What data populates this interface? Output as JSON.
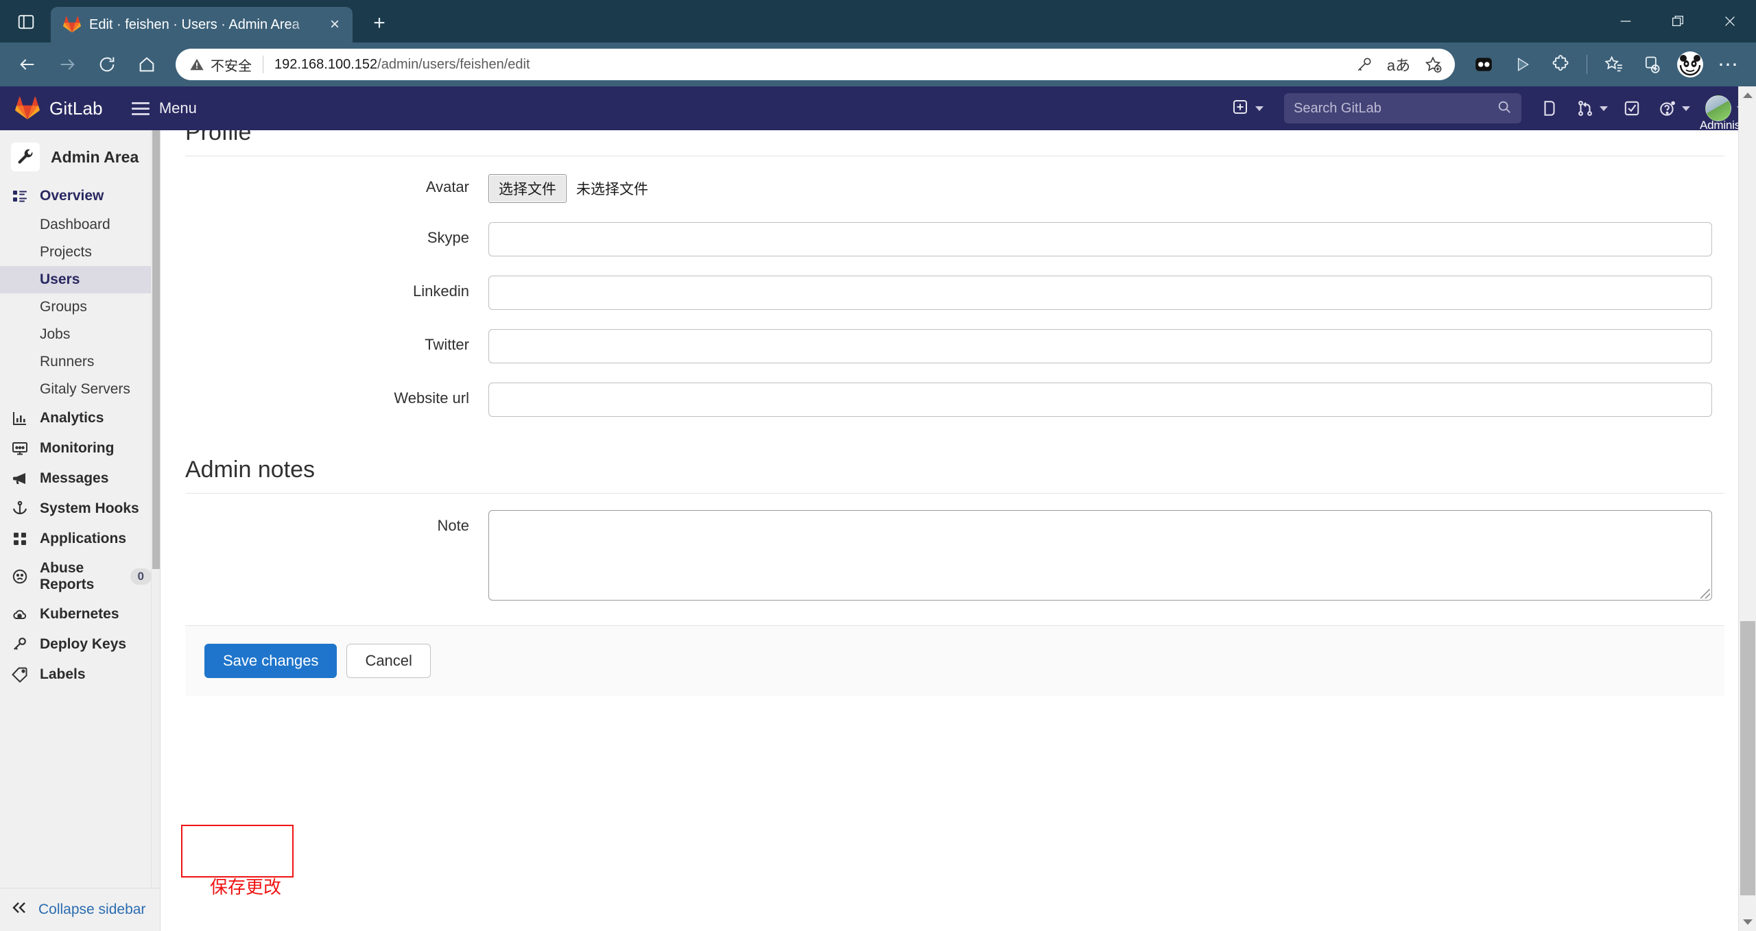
{
  "browser": {
    "tab": {
      "title": "Edit · feishen · Users · Admin Area",
      "favicon_name": "gitlab-favicon",
      "close_label": "×"
    },
    "newtab_label": "+",
    "omnibox": {
      "security_label": "不安全",
      "url_host": "192.168.100.152",
      "url_path": "/admin/users/feishen/edit",
      "icons": [
        "key-icon",
        "translate-icon",
        "add-favorite-icon"
      ]
    },
    "nav_icons": [
      "back-icon",
      "forward-icon",
      "reload-icon",
      "home-icon"
    ],
    "toolbar_icons": [
      "split-screen-icon",
      "play-icon",
      "extensions-icon",
      "favorites-icon",
      "collections-icon",
      "profile-avatar-icon",
      "settings-more-icon"
    ],
    "window_controls": [
      "minimize-icon",
      "restore-icon",
      "close-icon"
    ]
  },
  "gitlab_nav": {
    "brand": "GitLab",
    "menu_label": "Menu",
    "search_placeholder": "Search GitLab",
    "plus_icon": "plus-square-icon",
    "right_icons": [
      "issues-icon",
      "merge-requests-icon",
      "todos-icon",
      "help-icon"
    ],
    "user_name": "Administrator",
    "bg_color": "#292961"
  },
  "sidebar": {
    "header": "Admin Area",
    "header_icon": "wrench-icon",
    "collapse_label": "Collapse sidebar",
    "collapse_icon": "double-chevron-left-icon",
    "items": [
      {
        "label": "Overview",
        "icon": "overview-list-icon",
        "type": "section",
        "active": true
      },
      {
        "label": "Dashboard",
        "type": "sub"
      },
      {
        "label": "Projects",
        "type": "sub"
      },
      {
        "label": "Users",
        "type": "sub",
        "active": true
      },
      {
        "label": "Groups",
        "type": "sub"
      },
      {
        "label": "Jobs",
        "type": "sub"
      },
      {
        "label": "Runners",
        "type": "sub"
      },
      {
        "label": "Gitaly Servers",
        "type": "sub"
      },
      {
        "label": "Analytics",
        "icon": "chart-bar-icon",
        "type": "section"
      },
      {
        "label": "Monitoring",
        "icon": "monitor-icon",
        "type": "section"
      },
      {
        "label": "Messages",
        "icon": "megaphone-icon",
        "type": "section"
      },
      {
        "label": "System Hooks",
        "icon": "anchor-icon",
        "type": "section"
      },
      {
        "label": "Applications",
        "icon": "grid-apps-icon",
        "type": "section"
      },
      {
        "label": "Abuse Reports",
        "icon": "sad-face-icon",
        "type": "section",
        "badge": "0"
      },
      {
        "label": "Kubernetes",
        "icon": "cloud-gear-icon",
        "type": "section"
      },
      {
        "label": "Deploy Keys",
        "icon": "key-icon",
        "type": "section"
      },
      {
        "label": "Labels",
        "icon": "tag-icon",
        "type": "section"
      }
    ]
  },
  "main": {
    "profile_heading": "Profile",
    "admin_notes_heading": "Admin notes",
    "fields": [
      {
        "label": "Avatar",
        "kind": "file",
        "button_label": "选择文件",
        "status": "未选择文件"
      },
      {
        "label": "Skype",
        "kind": "text",
        "value": ""
      },
      {
        "label": "Linkedin",
        "kind": "text",
        "value": ""
      },
      {
        "label": "Twitter",
        "kind": "text",
        "value": ""
      },
      {
        "label": "Website url",
        "kind": "text",
        "value": ""
      }
    ],
    "note_field": {
      "label": "Note",
      "kind": "textarea",
      "value": ""
    },
    "actions": {
      "save_label": "Save changes",
      "cancel_label": "Cancel",
      "save_color": "#1f75cb"
    },
    "annotation": {
      "text": "保存更改",
      "color": "#f01414"
    }
  }
}
